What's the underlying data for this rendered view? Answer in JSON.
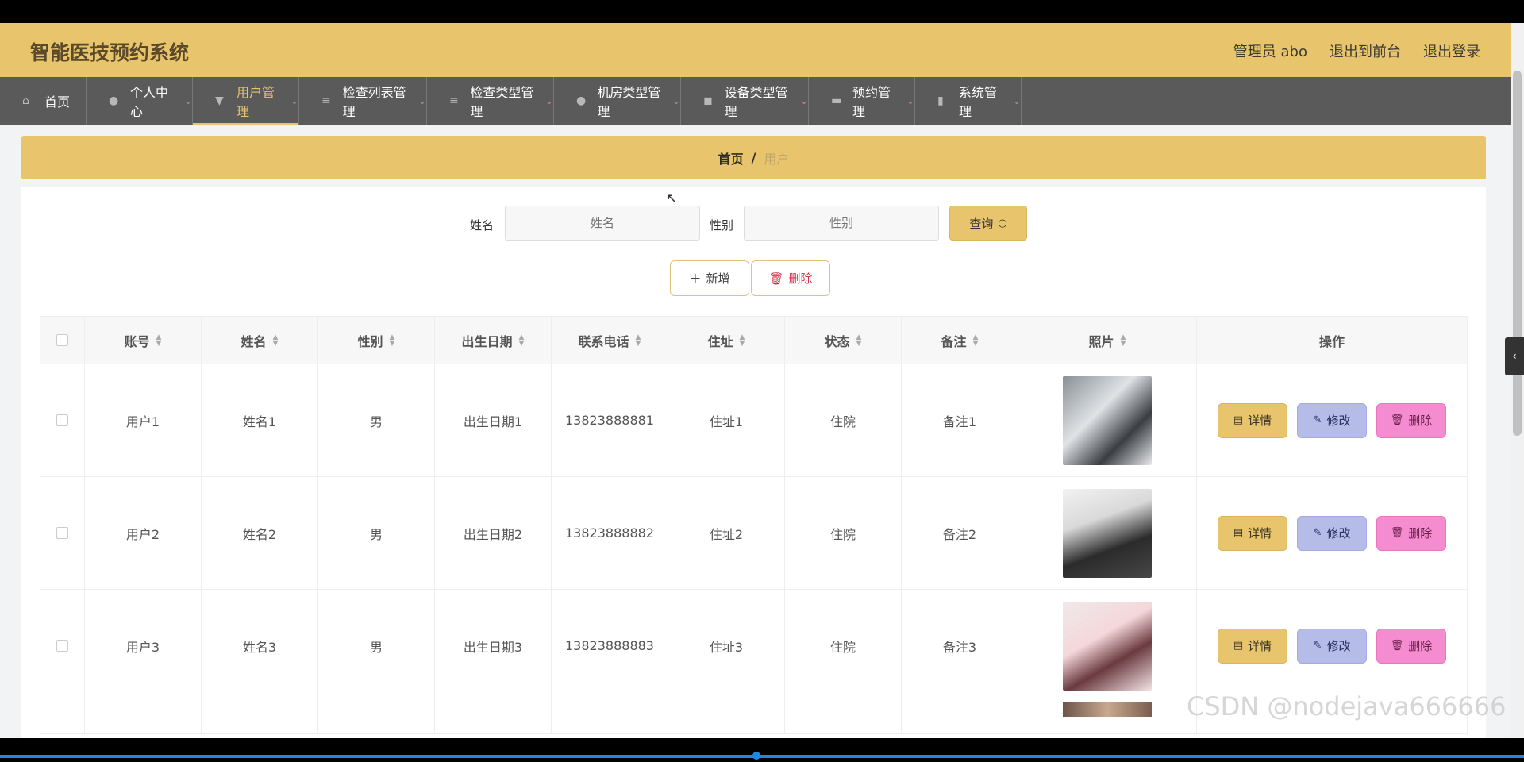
{
  "app": {
    "title": "智能医技预约系统"
  },
  "header": {
    "admin": "管理员 abo",
    "to_front": "退出到前台",
    "logout": "退出登录"
  },
  "nav": [
    {
      "label": "首页",
      "icon": "home-icon",
      "glyph": "⌂",
      "caret": false
    },
    {
      "label": "个人中心",
      "icon": "user-icon",
      "glyph": "●",
      "caret": true
    },
    {
      "label": "用户管理",
      "icon": "pin-icon",
      "glyph": "▼",
      "caret": true
    },
    {
      "label": "检查列表管理",
      "icon": "list-icon",
      "glyph": "≡",
      "caret": true
    },
    {
      "label": "检查类型管理",
      "icon": "list-icon",
      "glyph": "≡",
      "caret": true
    },
    {
      "label": "机房类型管理",
      "icon": "user-icon",
      "glyph": "●",
      "caret": true
    },
    {
      "label": "设备类型管理",
      "icon": "ticket-icon",
      "glyph": "◼",
      "caret": true
    },
    {
      "label": "预约管理",
      "icon": "monitor-icon",
      "glyph": "▬",
      "caret": true
    },
    {
      "label": "系统管理",
      "icon": "book-icon",
      "glyph": "▮",
      "caret": true
    }
  ],
  "breadcrumb": {
    "home": "首页",
    "separator": "/",
    "current": "用户"
  },
  "search": {
    "name_label": "姓名",
    "name_placeholder": "姓名",
    "gender_label": "性别",
    "gender_placeholder": "性别",
    "query_label": "查询"
  },
  "actions": {
    "add_label": "新增",
    "delete_label": "删除"
  },
  "table": {
    "columns": [
      "账号",
      "姓名",
      "性别",
      "出生日期",
      "联系电话",
      "住址",
      "状态",
      "备注",
      "照片",
      "操作"
    ],
    "rows": [
      {
        "account": "用户1",
        "name": "姓名1",
        "gender": "男",
        "birth": "出生日期1",
        "phone": "13823888881",
        "address": "住址1",
        "status": "住院",
        "note": "备注1"
      },
      {
        "account": "用户2",
        "name": "姓名2",
        "gender": "男",
        "birth": "出生日期2",
        "phone": "13823888882",
        "address": "住址2",
        "status": "住院",
        "note": "备注2"
      },
      {
        "account": "用户3",
        "name": "姓名3",
        "gender": "男",
        "birth": "出生日期3",
        "phone": "13823888883",
        "address": "住址3",
        "status": "住院",
        "note": "备注3"
      }
    ],
    "row_actions": {
      "detail": "详情",
      "edit": "修改",
      "delete": "删除"
    }
  },
  "watermark": "CSDN @nodejava666666",
  "colors": {
    "accent": "#e8c46c",
    "nav_bg": "#5a5a5a",
    "edit": "#b5bce8",
    "remove": "#f58cd0"
  }
}
